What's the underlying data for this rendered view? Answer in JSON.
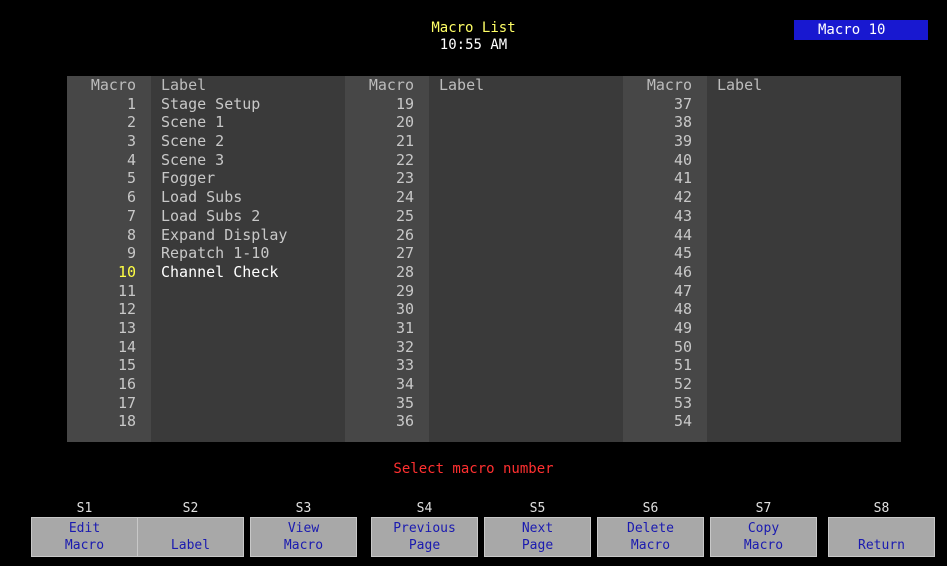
{
  "header": {
    "title": "Macro List",
    "time": "10:55 AM",
    "badge": "Macro 10"
  },
  "table": {
    "headers": {
      "number": "Macro",
      "label": "Label"
    },
    "columns": [
      {
        "rows": [
          {
            "n": "1",
            "l": "Stage Setup"
          },
          {
            "n": "2",
            "l": "Scene 1"
          },
          {
            "n": "3",
            "l": "Scene 2"
          },
          {
            "n": "4",
            "l": "Scene 3"
          },
          {
            "n": "5",
            "l": "Fogger"
          },
          {
            "n": "6",
            "l": "Load Subs"
          },
          {
            "n": "7",
            "l": "Load Subs 2"
          },
          {
            "n": "8",
            "l": "Expand Display"
          },
          {
            "n": "9",
            "l": "Repatch 1-10"
          },
          {
            "n": "10",
            "l": "Channel Check"
          },
          {
            "n": "11",
            "l": ""
          },
          {
            "n": "12",
            "l": ""
          },
          {
            "n": "13",
            "l": ""
          },
          {
            "n": "14",
            "l": ""
          },
          {
            "n": "15",
            "l": ""
          },
          {
            "n": "16",
            "l": ""
          },
          {
            "n": "17",
            "l": ""
          },
          {
            "n": "18",
            "l": ""
          }
        ]
      },
      {
        "rows": [
          {
            "n": "19",
            "l": ""
          },
          {
            "n": "20",
            "l": ""
          },
          {
            "n": "21",
            "l": ""
          },
          {
            "n": "22",
            "l": ""
          },
          {
            "n": "23",
            "l": ""
          },
          {
            "n": "24",
            "l": ""
          },
          {
            "n": "25",
            "l": ""
          },
          {
            "n": "26",
            "l": ""
          },
          {
            "n": "27",
            "l": ""
          },
          {
            "n": "28",
            "l": ""
          },
          {
            "n": "29",
            "l": ""
          },
          {
            "n": "30",
            "l": ""
          },
          {
            "n": "31",
            "l": ""
          },
          {
            "n": "32",
            "l": ""
          },
          {
            "n": "33",
            "l": ""
          },
          {
            "n": "34",
            "l": ""
          },
          {
            "n": "35",
            "l": ""
          },
          {
            "n": "36",
            "l": ""
          }
        ]
      },
      {
        "rows": [
          {
            "n": "37",
            "l": ""
          },
          {
            "n": "38",
            "l": ""
          },
          {
            "n": "39",
            "l": ""
          },
          {
            "n": "40",
            "l": ""
          },
          {
            "n": "41",
            "l": ""
          },
          {
            "n": "42",
            "l": ""
          },
          {
            "n": "43",
            "l": ""
          },
          {
            "n": "44",
            "l": ""
          },
          {
            "n": "45",
            "l": ""
          },
          {
            "n": "46",
            "l": ""
          },
          {
            "n": "47",
            "l": ""
          },
          {
            "n": "48",
            "l": ""
          },
          {
            "n": "49",
            "l": ""
          },
          {
            "n": "50",
            "l": ""
          },
          {
            "n": "51",
            "l": ""
          },
          {
            "n": "52",
            "l": ""
          },
          {
            "n": "53",
            "l": ""
          },
          {
            "n": "54",
            "l": ""
          }
        ]
      }
    ],
    "selected": "10"
  },
  "prompt": "Select macro number",
  "softkeys": [
    {
      "key": "S1",
      "line1": "Edit",
      "line2": "Macro"
    },
    {
      "key": "S2",
      "line1": "",
      "line2": "Label"
    },
    {
      "key": "S3",
      "line1": "View",
      "line2": "Macro"
    },
    {
      "key": "S4",
      "line1": "Previous",
      "line2": "Page"
    },
    {
      "key": "S5",
      "line1": "Next",
      "line2": "Page"
    },
    {
      "key": "S6",
      "line1": "Delete",
      "line2": "Macro"
    },
    {
      "key": "S7",
      "line1": "Copy",
      "line2": "Macro"
    },
    {
      "key": "S8",
      "line1": "",
      "line2": "Return"
    }
  ],
  "colors": {
    "background": "#000000",
    "badge": "#1818d0",
    "selected": "#ffff44",
    "prompt": "#ff3030",
    "softkey_text": "#1a1ab0"
  }
}
